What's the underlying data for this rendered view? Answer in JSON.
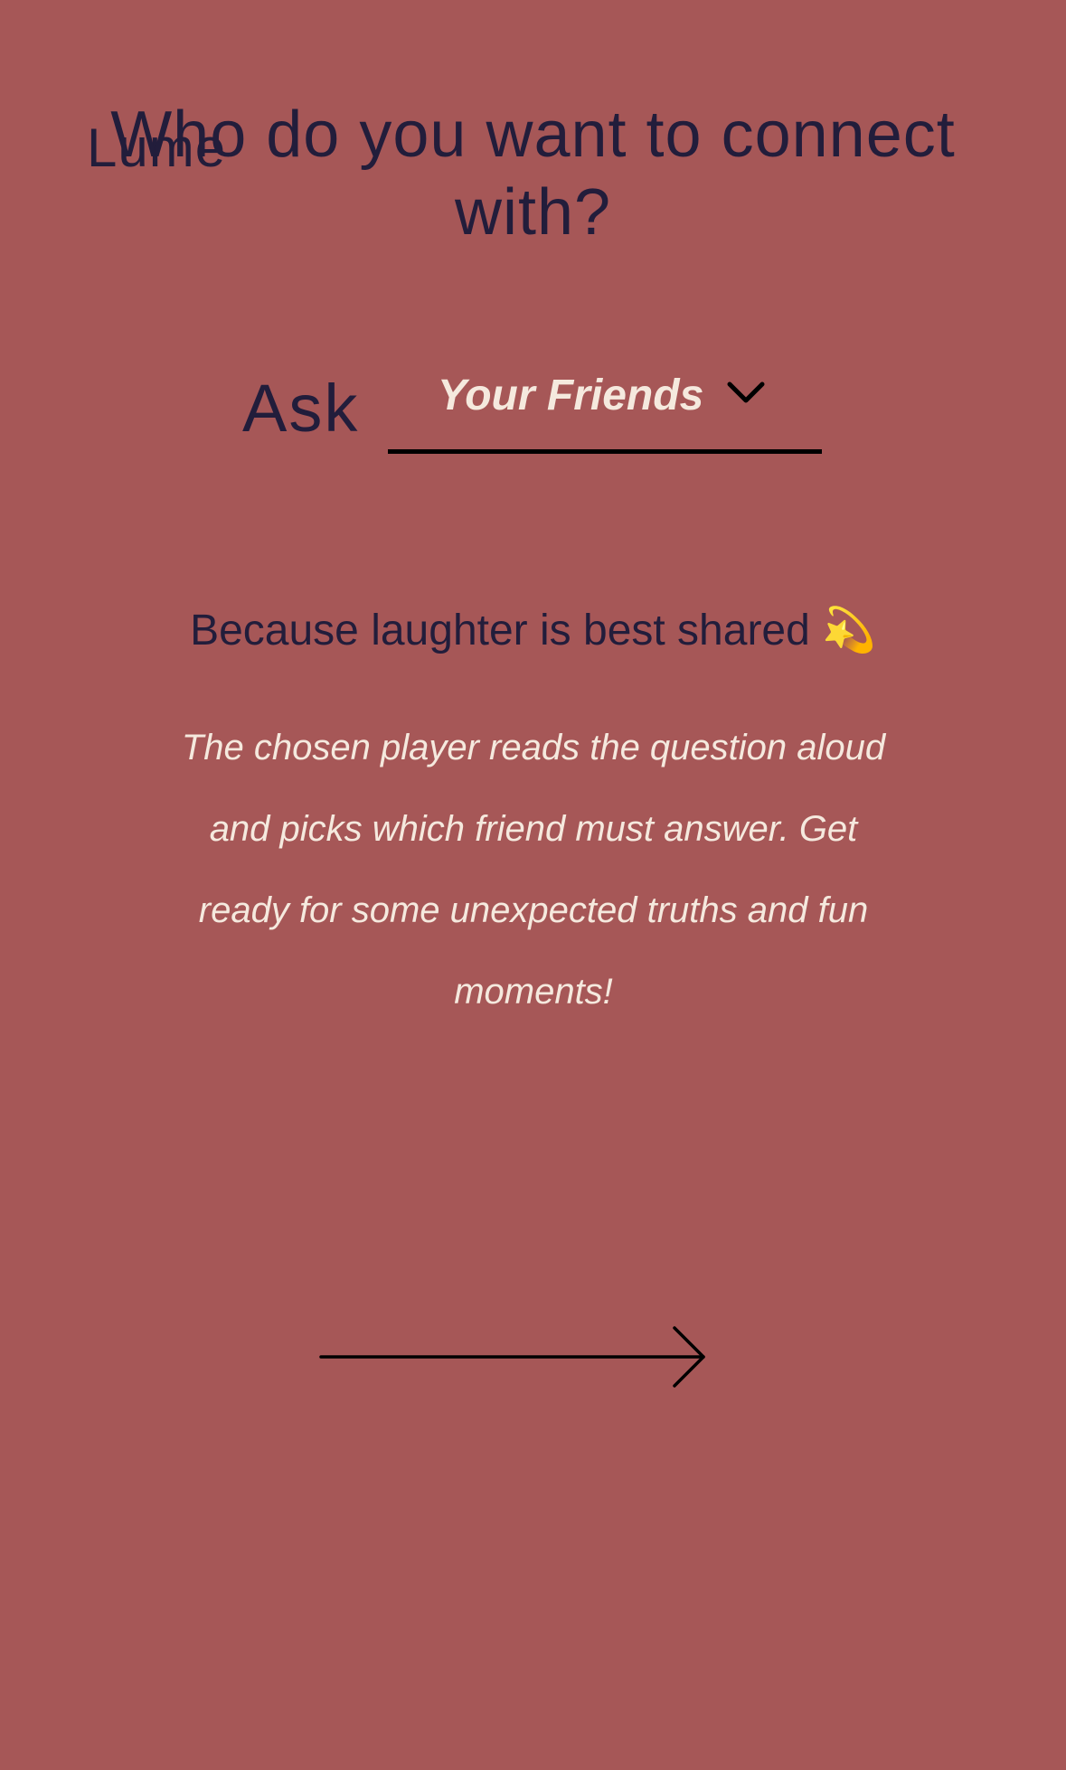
{
  "app": {
    "brand": "Lume"
  },
  "header": {
    "title": "Who do you want to connect with?"
  },
  "selector": {
    "prefix": "Ask",
    "selected_value": "Your Friends"
  },
  "tagline": {
    "text": "Because laughter is best shared 💫"
  },
  "description": {
    "text": "The chosen player reads the question aloud and picks which friend must answer. Get ready for some unexpected truths and fun moments!"
  },
  "icons": {
    "dropdown": "chevron-down-icon",
    "next": "arrow-right-icon"
  },
  "colors": {
    "background": "#a65757",
    "primary_text": "#221d3b",
    "light_text": "#f5e9de",
    "line": "#000000"
  }
}
